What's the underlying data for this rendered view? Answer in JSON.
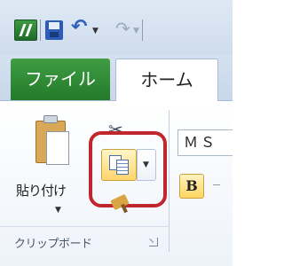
{
  "qat": {
    "excel_icon": "excel-icon",
    "save_icon": "save-icon",
    "undo_glyph": "↶",
    "redo_glyph": "↷",
    "caret": "▼"
  },
  "tabs": {
    "file_label": "ファイル",
    "home_label": "ホーム"
  },
  "clipboard": {
    "paste_label": "貼り付け",
    "paste_caret": "▼",
    "cut_glyph": "✂",
    "copy_caret": "▼",
    "group_label": "クリップボード"
  },
  "font": {
    "font_name": "ＭＳ",
    "bold_label": "B"
  },
  "colors": {
    "file_tab": "#2f8a35",
    "highlight": "#c0262d",
    "copy_button": "#ffd56b"
  }
}
